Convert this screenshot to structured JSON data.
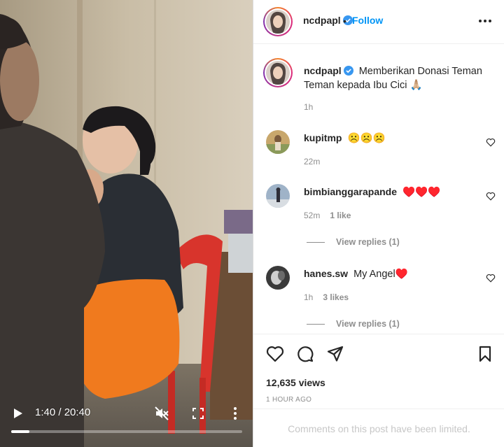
{
  "video": {
    "time_display": "1:40 / 20:40",
    "progress_fraction": 0.08
  },
  "header": {
    "username": "ncdpapl",
    "separator": "•",
    "follow_label": "Follow"
  },
  "caption": {
    "username": "ncdpapl",
    "text": "Memberikan Donasi Teman Teman kepada Ibu Cici 🙏🏼",
    "time": "1h"
  },
  "comments": [
    {
      "username": "kupitmp",
      "text": "☹️☹️☹️",
      "time": "22m",
      "likes": ""
    },
    {
      "username": "bimbianggarapande",
      "text": "♥️♥️♥️",
      "time": "52m",
      "likes": "1 like",
      "view_replies": "View replies (1)"
    },
    {
      "username": "hanes.sw",
      "text": "My Angel♥️",
      "time": "1h",
      "likes": "3 likes",
      "view_replies": "View replies (1)"
    }
  ],
  "stats": {
    "views": "12,635 views",
    "posted": "1 HOUR AGO",
    "comments_limited": "Comments on this post have been limited."
  },
  "colors": {
    "accent": "#0095f6",
    "verified": "#3897f0",
    "heart_emoji": "#c0002a"
  }
}
